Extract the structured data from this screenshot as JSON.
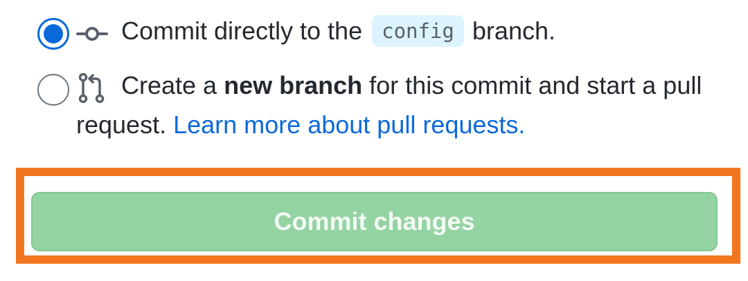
{
  "commit_options": {
    "selected": "direct",
    "direct": {
      "text_before": "Commit directly to the",
      "branch_name": "config",
      "text_after": "branch."
    },
    "new_branch": {
      "text_before": "Create a",
      "bold_text": "new branch",
      "text_after": "for this commit and start a pull request.",
      "link_text": "Learn more about pull requests."
    }
  },
  "icons": {
    "commit": "git-commit-icon",
    "pull_request": "git-pull-request-icon"
  },
  "commit_button": {
    "label": "Commit changes",
    "disabled": true
  },
  "highlight_color": "#f27620",
  "colors": {
    "accent": "#0969da",
    "button_bg": "#94d3a2",
    "code_chip_bg": "#ddf4ff"
  }
}
